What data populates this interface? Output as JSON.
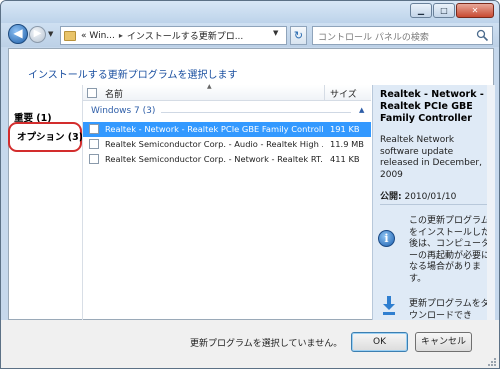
{
  "addressbar": {
    "crumbs": [
      "«  Win...",
      "インストールする更新プロ..."
    ],
    "search_placeholder": "コントロール パネルの検索"
  },
  "main": {
    "heading": "インストールする更新プログラムを選択します"
  },
  "leftpanel": {
    "important_label": "重要 (1)",
    "optional_label": "オプション (3)"
  },
  "list": {
    "columns": {
      "name": "名前",
      "size": "サイズ"
    },
    "group_label": "Windows 7 (3)",
    "rows": [
      {
        "name": "Realtek - Network - Realtek PCIe GBE Family Controller",
        "size": "191 KB",
        "selected": true
      },
      {
        "name": "Realtek Semiconductor Corp. - Audio - Realtek High ...",
        "size": "11.9 MB",
        "selected": false
      },
      {
        "name": "Realtek Semiconductor Corp. - Network - Realtek RT...",
        "size": "411 KB",
        "selected": false
      }
    ]
  },
  "details": {
    "title": "Realtek - Network - Realtek PCIe GBE Family Controller",
    "description": "Realtek Network software update released in December, 2009",
    "published_label": "公開:",
    "published_date": "2010/01/10",
    "restart_note": "この更新プログラムをインストールした後は、コンピューターの再起動が必要になる場合があります。",
    "download_note": "更新プログラムをダウンロードでき"
  },
  "footer": {
    "status": "更新プログラムを選択していません。",
    "ok_label": "OK",
    "cancel_label": "キャンセル"
  },
  "colors": {
    "accent": "#3399ff",
    "heading": "#1a4fa0",
    "highlight_ring": "#d32d2d"
  }
}
